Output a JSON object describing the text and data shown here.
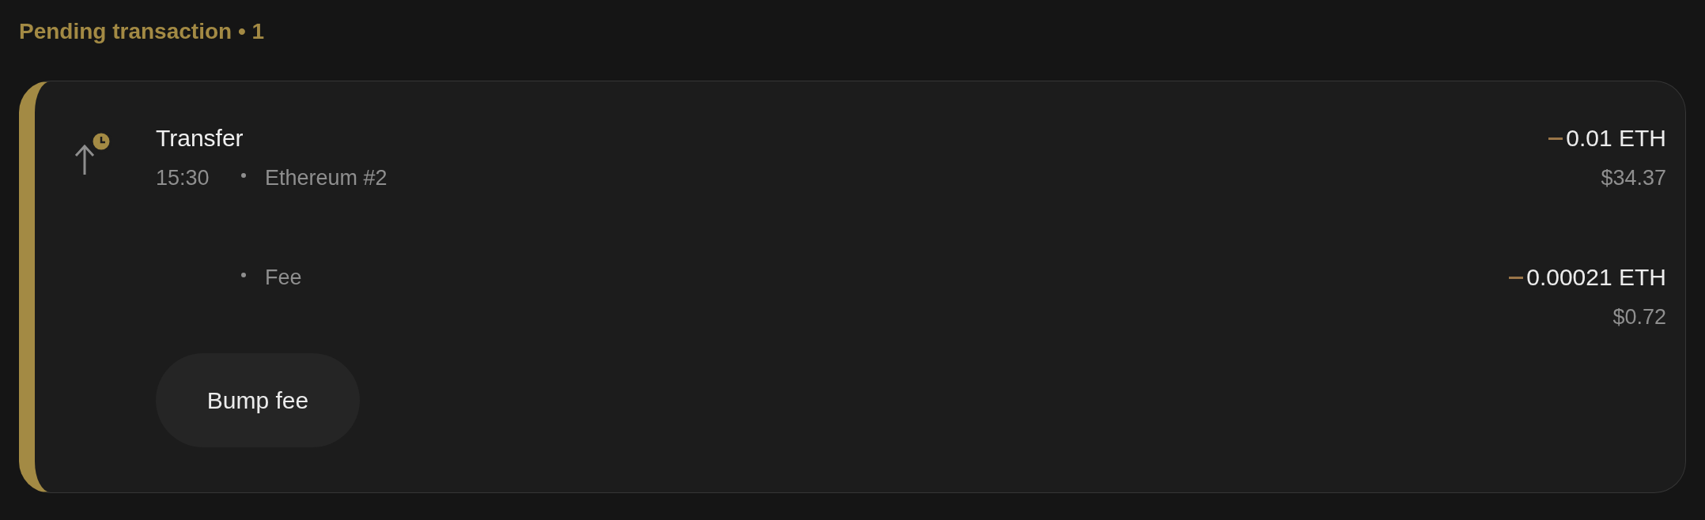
{
  "section_title": "Pending transaction • 1",
  "transaction": {
    "title": "Transfer",
    "time": "15:30",
    "account": "Ethereum #2",
    "pending": true,
    "amount": {
      "negative": true,
      "value": "0.01 ETH",
      "fiat": "$34.37"
    },
    "fee": {
      "label": "Fee",
      "negative": true,
      "value": "0.00021 ETH",
      "fiat": "$0.72"
    },
    "action": "Bump fee"
  }
}
